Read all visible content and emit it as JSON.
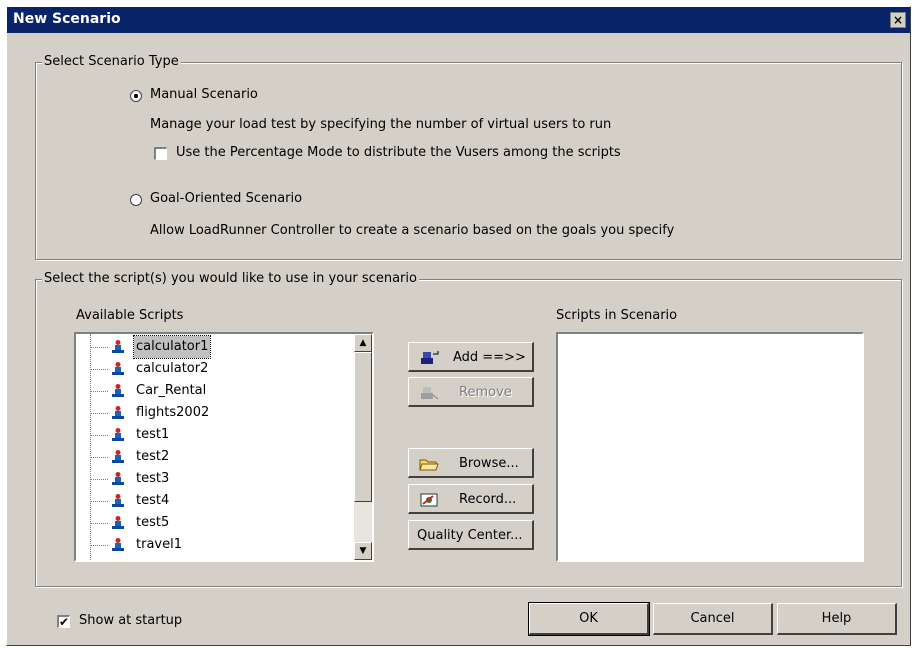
{
  "window": {
    "title": "New Scenario",
    "close": "×"
  },
  "scenario_type": {
    "legend": "Select Scenario Type",
    "manual": {
      "label": "Manual Scenario",
      "selected": true,
      "description": "Manage your load test by specifying the number of virtual users to run",
      "percentage_mode": {
        "label": "Use the Percentage Mode to distribute the Vusers among the scripts",
        "checked": false
      }
    },
    "goal": {
      "label": "Goal-Oriented Scenario",
      "selected": false,
      "description": "Allow LoadRunner Controller to create a scenario based on the goals you specify"
    }
  },
  "scripts": {
    "legend": "Select the script(s) you would like to use in your scenario",
    "available_label": "Available Scripts",
    "in_scenario_label": "Scripts in Scenario",
    "available": [
      {
        "label": "calculator1",
        "selected": true
      },
      {
        "label": "calculator2"
      },
      {
        "label": "Car_Rental"
      },
      {
        "label": "flights2002"
      },
      {
        "label": "test1"
      },
      {
        "label": "test2"
      },
      {
        "label": "test3"
      },
      {
        "label": "test4"
      },
      {
        "label": "test5"
      },
      {
        "label": "travel1"
      }
    ],
    "in_scenario": [],
    "buttons": {
      "add": "Add ==>>",
      "remove": "Remove",
      "browse": "Browse...",
      "record": "Record...",
      "quality_center": "Quality Center..."
    }
  },
  "footer": {
    "show_at_startup": {
      "label": "Show at startup",
      "checked": true,
      "mark": "✔"
    },
    "ok": "OK",
    "cancel": "Cancel",
    "help": "Help"
  },
  "scrollbar": {
    "up": "▲",
    "down": "▼"
  },
  "icons": {
    "script": "script-icon",
    "add": "add-icon",
    "remove": "remove-icon",
    "browse": "folder-open-icon",
    "record": "record-icon"
  },
  "colors": {
    "titlebar": "#0a246a",
    "face": "#d4d0c8",
    "selection": "#c0c0c0"
  }
}
